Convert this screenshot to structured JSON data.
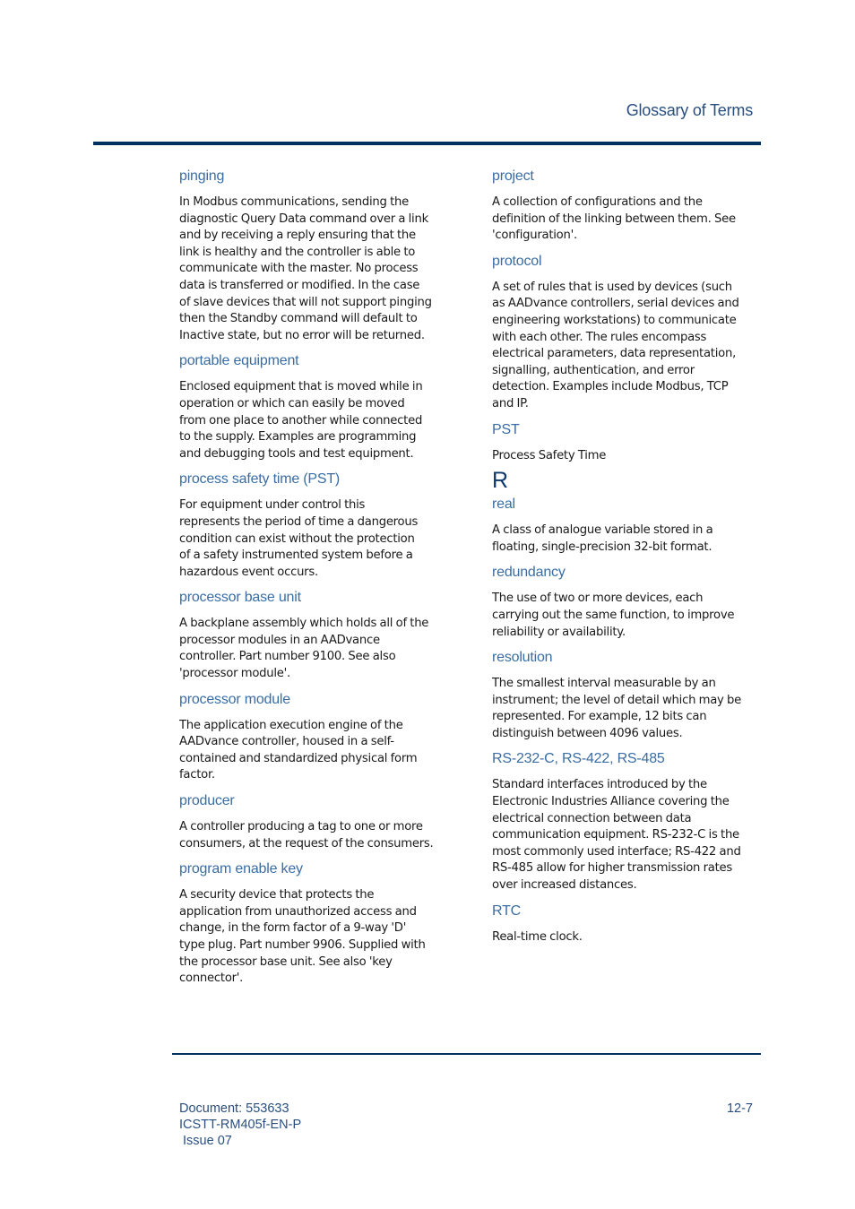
{
  "header": {
    "title": "Glossary of Terms"
  },
  "left_column": [
    {
      "term": "pinging",
      "definition": "In Modbus communications, sending the\ndiagnostic Query Data command over a link\nand by receiving a reply ensuring that the\nlink is healthy and the controller is able to\ncommunicate with the master. No process\ndata is transferred or modified. In the case\nof slave devices that will not support pinging\nthen the Standby command will default to\nInactive state, but no error will be returned."
    },
    {
      "term": "portable equipment",
      "definition": "Enclosed equipment that is moved while in\noperation or which can easily be moved\nfrom one place to another while connected\nto the supply. Examples are programming\nand debugging tools and test equipment."
    },
    {
      "term": "process safety time (PST)",
      "definition": " For equipment under control this\nrepresents the period of time a dangerous\ncondition can exist without the protection\nof a safety instrumented system before a\nhazardous event occurs."
    },
    {
      "term": "processor base unit",
      "definition": "A backplane assembly which holds all of the\nprocessor modules in an AADvance\ncontroller. Part number 9100. See also\n'processor module'."
    },
    {
      "term": "processor module",
      "definition": "The application execution engine of the\nAADvance controller, housed in a self-\ncontained and standardized physical form\nfactor."
    },
    {
      "term": "producer",
      "definition": "A controller producing a tag to one or more\nconsumers, at the request of the consumers."
    },
    {
      "term": "program enable key",
      "definition": "A security device that protects the\napplication from unauthorized access and\nchange, in the form factor of a 9-way 'D'\ntype plug. Part number 9906. Supplied with\nthe processor base unit. See also 'key\nconnector'."
    }
  ],
  "right_column_p": [
    {
      "term": "project",
      "definition": "A collection of configurations and the\ndefinition of the linking between them. See\n'configuration'."
    },
    {
      "term": "protocol",
      "definition": "A set of rules that is used by devices (such\nas AADvance controllers, serial devices and\nengineering workstations) to communicate\nwith each other. The rules encompass\nelectrical parameters, data representation,\nsignalling, authentication, and error\ndetection. Examples include Modbus, TCP\nand IP."
    },
    {
      "term": "PST",
      "definition": "Process Safety Time"
    }
  ],
  "section_letter": "R",
  "right_column_r": [
    {
      "term": "real",
      "definition": "A class of analogue variable stored in a\nfloating, single-precision 32-bit format."
    },
    {
      "term": "redundancy",
      "definition": "The use of two or more devices, each\ncarrying out the same function, to improve\nreliability or availability."
    },
    {
      "term": "resolution",
      "definition": "The smallest interval measurable by an\ninstrument; the level of detail which may be\nrepresented. For example, 12 bits can\ndistinguish between 4096 values."
    },
    {
      "term": "RS-232-C, RS-422, RS-485",
      "definition": "Standard interfaces introduced by the\nElectronic Industries Alliance covering the\nelectrical connection between data\ncommunication equipment. RS-232-C is the\nmost commonly used interface; RS-422 and\nRS-485 allow for higher transmission rates\nover increased distances."
    },
    {
      "term": "RTC",
      "definition": "Real-time clock."
    }
  ],
  "footer": {
    "document": "Document: 553633",
    "code": "ICSTT-RM405f-EN-P",
    "issue": " Issue 07",
    "page_number": "12-7"
  }
}
